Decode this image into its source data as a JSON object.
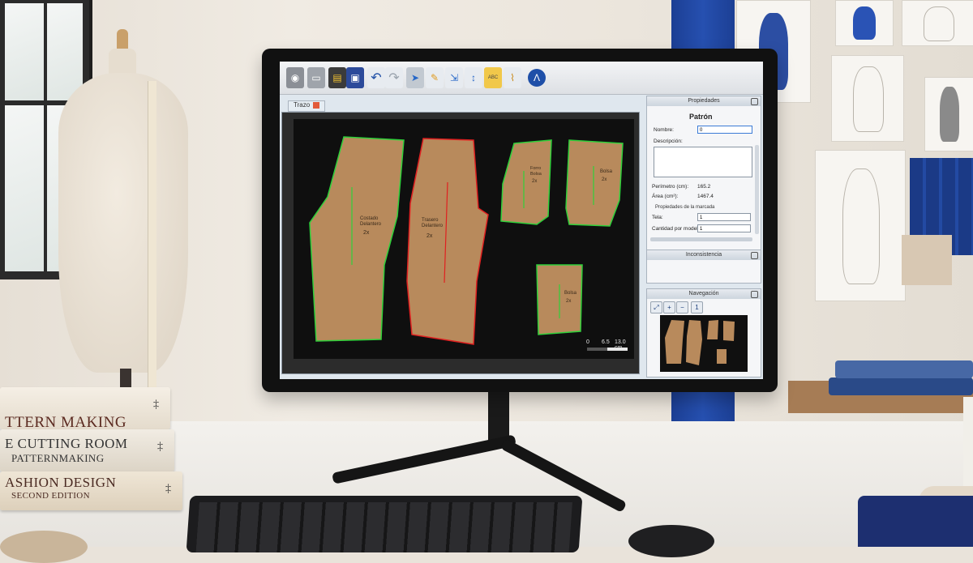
{
  "books": [
    {
      "title": "TTERN MAKING",
      "subtitle": ""
    },
    {
      "title": "E CUTTING ROOM",
      "subtitle": "PATTERNMAKING"
    },
    {
      "title": "ASHION DESIGN",
      "subtitle": "SECOND EDITION"
    }
  ],
  "app": {
    "toolbar": {
      "icons": [
        "camera-icon",
        "scanner-icon",
        "open-folder-icon",
        "save-icon",
        "undo-icon",
        "redo-icon",
        "select-pointer-icon",
        "pencil-icon",
        "export-icon",
        "measure-ruler-icon",
        "text-label-icon",
        "grading-icon",
        "logo-icon"
      ],
      "text_tool_label": "ABC"
    },
    "document_tab": "Trazo",
    "canvas": {
      "background": "#0f0f0f",
      "pieces": [
        {
          "name": "front-leg",
          "text": "Costado Delantero 2x",
          "outline": "green"
        },
        {
          "name": "back-leg",
          "text": "Trasero Delantero 2x",
          "outline": "red"
        },
        {
          "name": "pocket-1",
          "text": "Forro Bolsa 2x",
          "outline": "green"
        },
        {
          "name": "pocket-2",
          "text": "Bolsa 2x",
          "outline": "green"
        },
        {
          "name": "pocket-3",
          "text": "Bolsa 2x",
          "outline": "green"
        }
      ],
      "scale": [
        "0",
        "6.5",
        "13.0 cm"
      ]
    },
    "properties": {
      "header": "Propiedades",
      "title": "Patrón",
      "name_label": "Nombre:",
      "name_value": "0",
      "description_label": "Descripción:",
      "perimeter_label": "Perímetro (cm):",
      "perimeter_value": "165.2",
      "area_label": "Área (cm²):",
      "area_value": "1467.4",
      "marker_section": "Propiedades de la marcada",
      "fabric_label": "Tela:",
      "fabric_value": "1",
      "qty_label": "Cantidad por modelo:",
      "qty_value": "1"
    },
    "inconsistency": {
      "header": "Inconsistencia"
    },
    "navigation": {
      "header": "Navegación",
      "buttons": [
        "fit-view-icon",
        "zoom-in-icon",
        "zoom-out-icon",
        "zoom-actual-icon"
      ]
    },
    "colors": {
      "accent": "#1a5fb4",
      "piece_fill": "#b88a5c",
      "outline_green": "#2fd03a",
      "outline_red": "#e02020"
    }
  }
}
